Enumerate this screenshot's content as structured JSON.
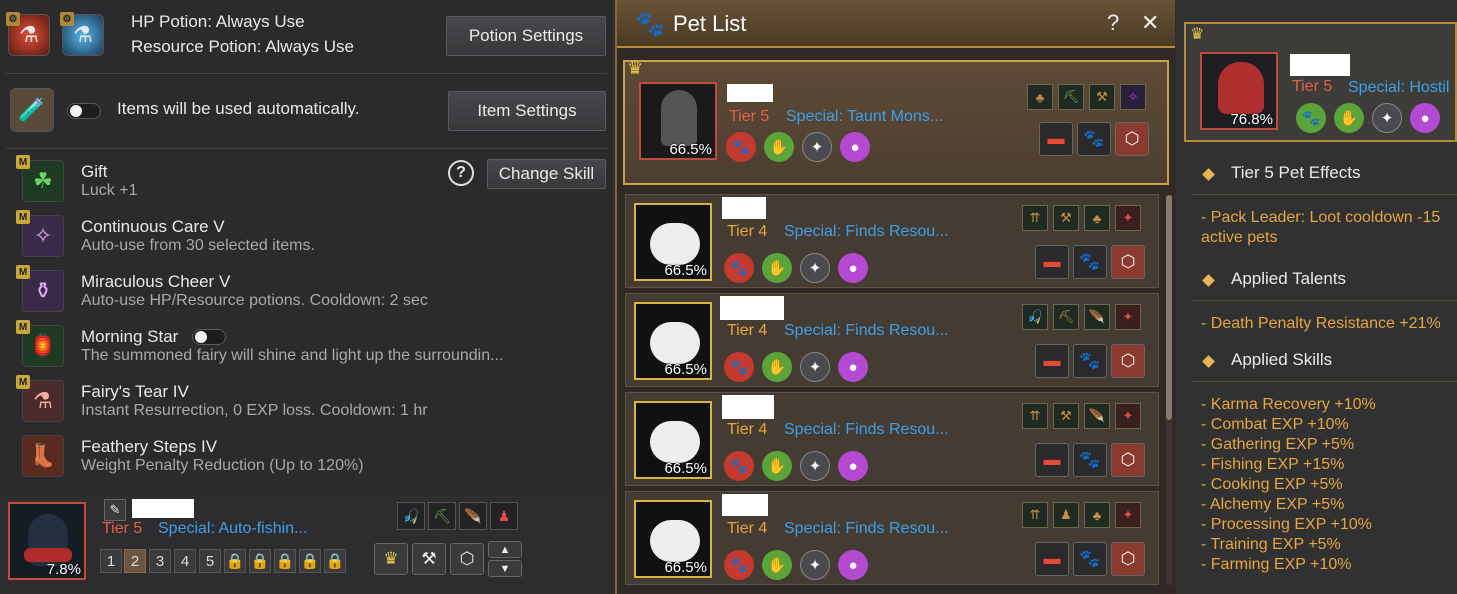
{
  "potions": {
    "hp_line": "HP Potion: Always Use",
    "resource_line": "Resource Potion: Always Use",
    "settings_button": "Potion Settings"
  },
  "items": {
    "auto_text": "Items will be used automatically.",
    "settings_button": "Item Settings"
  },
  "skills": {
    "lock_badge": "M",
    "help_glyph": "?",
    "change_button": "Change Skill",
    "list": [
      {
        "title": "Gift",
        "desc": "Luck +1"
      },
      {
        "title": "Continuous Care V",
        "desc": "Auto-use from 30 selected items."
      },
      {
        "title": "Miraculous Cheer V",
        "desc": "Auto-use HP/Resource potions. Cooldown: 2 sec"
      },
      {
        "title": "Morning Star",
        "desc": "The summoned fairy will shine and light up the surroundin..."
      },
      {
        "title": "Fairy's Tear IV",
        "desc": "Instant Resurrection, 0 EXP loss. Cooldown: 1 hr"
      },
      {
        "title": "Feathery Steps IV",
        "desc": "Weight Penalty Reduction (Up to 120%)"
      }
    ]
  },
  "bottom_pet": {
    "pct": "7.8%",
    "tier": "Tier 5",
    "special": "Special: Auto-fishin...",
    "slots": [
      "1",
      "2",
      "3",
      "4",
      "5"
    ],
    "selected_slot": "2"
  },
  "pet_list": {
    "title": "Pet List",
    "help": "?",
    "close": "✕",
    "pets": [
      {
        "tier": "Tier 5",
        "special": "Special: Taunt Mons...",
        "pct": "66.5%"
      },
      {
        "tier": "Tier 4",
        "special": "Special: Finds Resou...",
        "pct": "66.5%"
      },
      {
        "tier": "Tier 4",
        "special": "Special: Finds Resou...",
        "pct": "66.5%"
      },
      {
        "tier": "Tier 4",
        "special": "Special: Finds Resou...",
        "pct": "66.5%"
      },
      {
        "tier": "Tier 4",
        "special": "Special: Finds Resou...",
        "pct": "66.5%"
      }
    ]
  },
  "detail": {
    "tier": "Tier 5",
    "special": "Special: Hostil",
    "pct": "76.8%",
    "effects_heading": "Tier 5 Pet Effects",
    "effect_line1": "- Pack Leader: Loot cooldown -15",
    "effect_line2": "active pets",
    "talents_heading": "Applied Talents",
    "talent_line": "- Death Penalty Resistance +21%",
    "skills_heading": "Applied Skills",
    "skill_lines": [
      "- Karma Recovery +10%",
      "- Combat EXP +10%",
      "- Gathering EXP +5%",
      "- Fishing EXP +15%",
      "- Cooking EXP +5%",
      "- Alchemy EXP +5%",
      "- Processing EXP +10%",
      "- Training EXP +5%",
      "- Farming EXP +10%"
    ]
  },
  "colors": {
    "tier5": "#e3614a",
    "tier4": "#e9a43a",
    "special": "#3fa0e8",
    "gold": "#c9a24a",
    "orange_text": "#e6a640"
  }
}
